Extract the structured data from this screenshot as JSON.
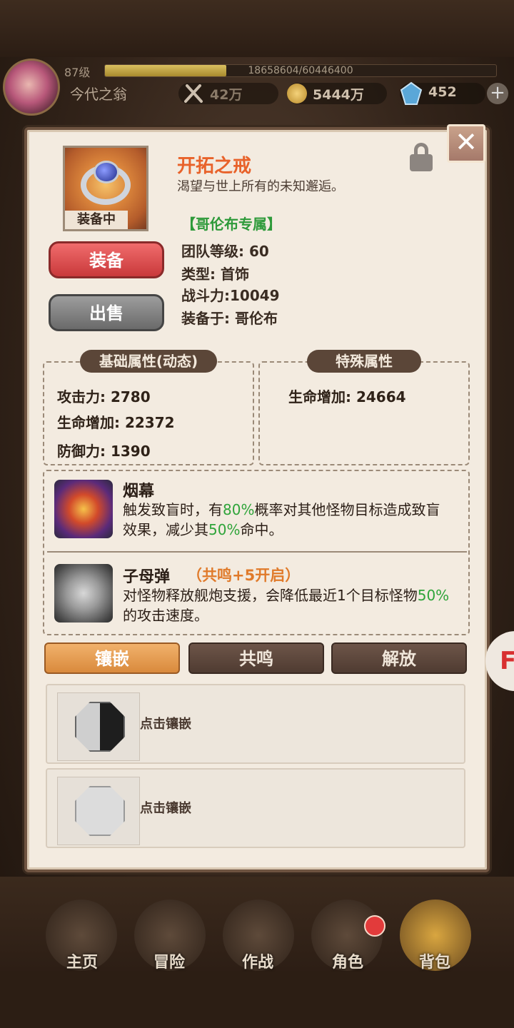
{
  "player": {
    "level": "87级",
    "exp_text": "18658604/60446400",
    "exp_progress": 0.31,
    "name": "今代之翁",
    "power": "42万",
    "gold": "5444万",
    "gems": "452"
  },
  "item": {
    "title": "开拓之戒",
    "description": "渴望与世上所有的未知邂逅。",
    "badge": "装备中",
    "exclusive": "【哥伦布专属】",
    "team_level": "团队等级: 60",
    "type": "类型: 首饰",
    "combat_power": "战斗力:10049",
    "equipped_on": "装备于: 哥伦布"
  },
  "buttons": {
    "equip": "装备",
    "sell": "出售",
    "close": "✕",
    "plus": "+"
  },
  "base_attrs": {
    "title": "基础属性(动态)",
    "lines": [
      "攻击力: 2780",
      "生命增加: 22372",
      "防御力: 1390"
    ]
  },
  "special_attrs": {
    "title": "特殊属性",
    "lines": [
      "生命增加: 24664"
    ]
  },
  "skills": [
    {
      "name": "烟幕",
      "text_parts": [
        "触发致盲时，有",
        "80%",
        "概率对其他怪物目标造成致盲效果，减少其",
        "50%",
        "命中。"
      ]
    },
    {
      "name": "子母弹",
      "resonance": "（共鸣+5开启）",
      "text_parts": [
        "对怪物释放舰炮支援，会降低最近1个目标怪物",
        "50%",
        "的攻击速度。"
      ]
    }
  ],
  "tabs": [
    "镶嵌",
    "共鸣",
    "解放"
  ],
  "slots": [
    "点击镶嵌",
    "点击镶嵌"
  ],
  "side_button": "F",
  "nav": [
    "主页",
    "冒险",
    "作战",
    "角色",
    "背包"
  ],
  "colors": {
    "accent_orange": "#e8622a",
    "green": "#2fa43a",
    "panel_bg": "#f3ebe0"
  },
  "icons": [
    "sword-icon",
    "coin-icon",
    "gem-icon",
    "lock-icon",
    "ring-icon",
    "smoke-skill-icon",
    "cluster-bomb-skill-icon"
  ]
}
